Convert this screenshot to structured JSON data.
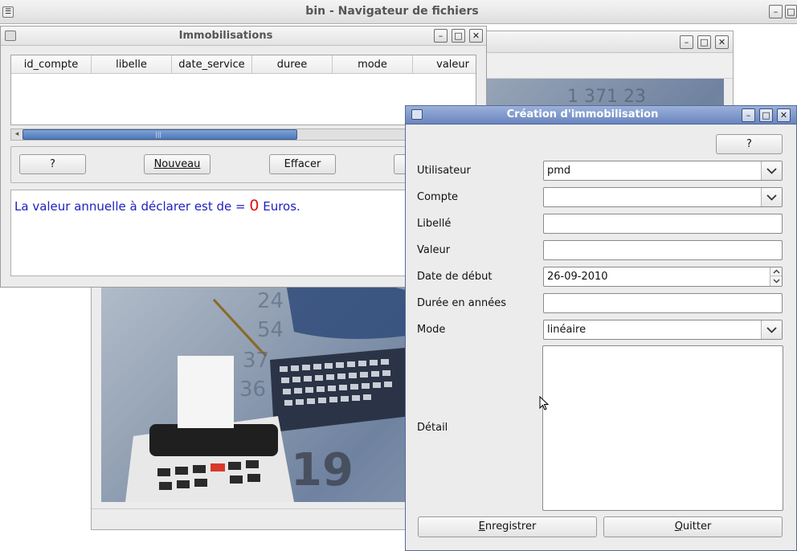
{
  "file_manager": {
    "title": "bin - Navigateur de fichiers"
  },
  "immobilisations": {
    "title": "Immobilisations",
    "columns": [
      "id_compte",
      "libelle",
      "date_service",
      "duree",
      "mode",
      "valeur"
    ],
    "buttons": {
      "help": "?",
      "new": "Nouveau",
      "clear": "Effacer"
    },
    "message_prefix": "La valeur annuelle à déclarer est de = ",
    "message_value": "0",
    "message_suffix": " Euros."
  },
  "creation": {
    "title": "Création d'immobilisation",
    "help": "?",
    "fields": {
      "utilisateur": {
        "label": "Utilisateur",
        "value": "pmd"
      },
      "compte": {
        "label": "Compte",
        "value": ""
      },
      "libelle": {
        "label": "Libellé",
        "value": ""
      },
      "valeur": {
        "label": "Valeur",
        "value": ""
      },
      "date_debut": {
        "label": "Date de début",
        "value": "26-09-2010"
      },
      "duree": {
        "label": "Durée en années",
        "value": ""
      },
      "mode": {
        "label": "Mode",
        "value": "linéaire"
      },
      "detail": {
        "label": "Détail",
        "value": ""
      }
    },
    "buttons": {
      "save": "Enregistrer",
      "quit": "Quitter"
    }
  },
  "background_digits": [
    "24",
    "54",
    "37",
    "36",
    "19",
    "1 371 23"
  ],
  "colors": {
    "titlebar_active": "#7d97cb",
    "message_text": "#2020c0",
    "message_value": "#e01010"
  }
}
